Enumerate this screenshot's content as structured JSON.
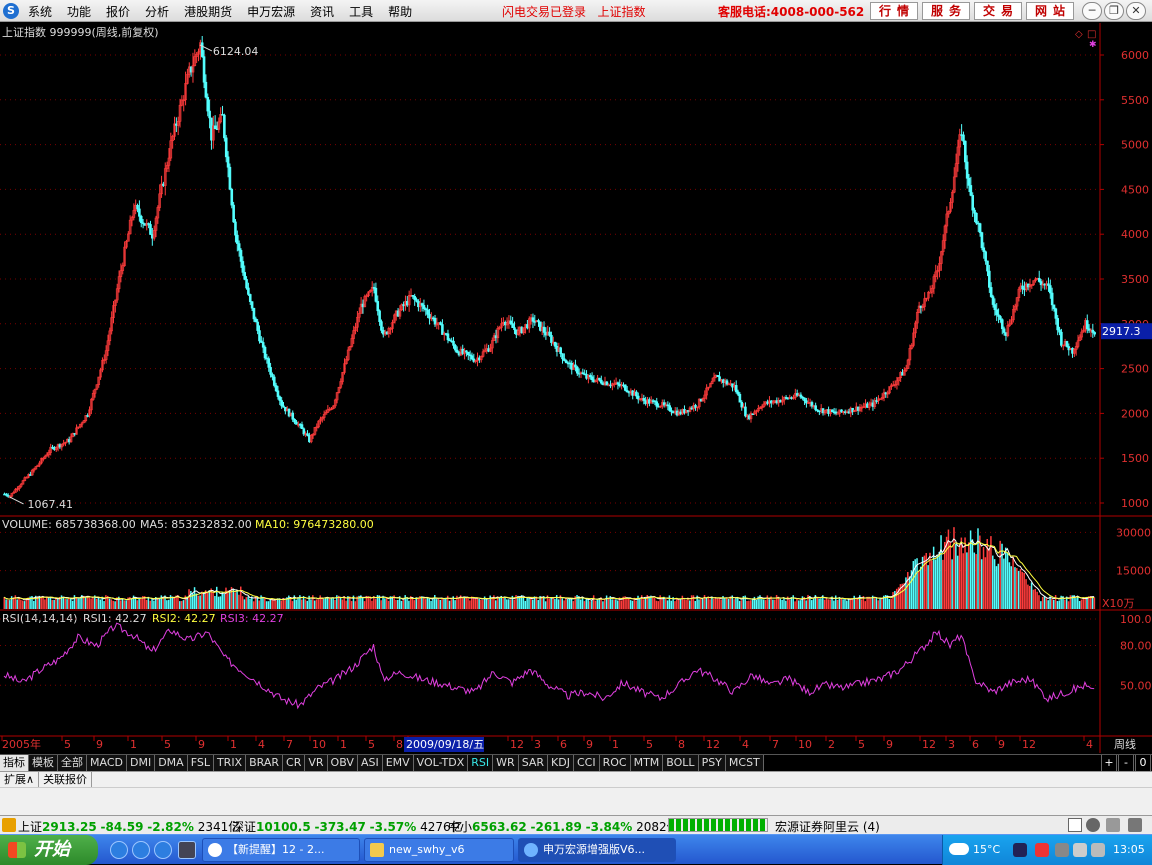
{
  "menubar": {
    "logo": "S",
    "items": [
      "系统",
      "功能",
      "报价",
      "分析",
      "港股期货",
      "申万宏源",
      "资讯",
      "工具",
      "帮助"
    ],
    "login_status": "闪电交易已登录",
    "current_index": "上证指数",
    "hotline": "客服电话:4008-000-562",
    "nav_buttons": [
      "行情",
      "服务",
      "交易",
      "网站"
    ]
  },
  "chart": {
    "title": "上证指数 999999(周线,前复权)",
    "high_label": "6124.04",
    "low_label": "1067.41",
    "current_price_tag": "2917.3",
    "period_label": "周线",
    "date_cursor": "2009/09/18/五",
    "price_ticks": [
      "6000",
      "5500",
      "5000",
      "4500",
      "4000",
      "3500",
      "3000",
      "2500",
      "2000",
      "1500",
      "1000"
    ],
    "volume_label": "VOLUME: 685738368.00",
    "ma5_label": "MA5: 853232832.00",
    "ma10_label": "MA10: 976473280.00",
    "volume_ticks": [
      "30000",
      "15000"
    ],
    "volume_unit": "X10万",
    "rsi_label": "RSI(14,14,14)",
    "rsi1_label": "RSI1: 42.27",
    "rsi2_label": "RSI2: 42.27",
    "rsi3_label": "RSI3: 42.27",
    "rsi_ticks": [
      "100.00",
      "80.00",
      "50.00"
    ],
    "x_ticks": [
      "2005年",
      "5",
      "9",
      "1",
      "5",
      "9",
      "1",
      "4",
      "7",
      "10",
      "1",
      "5",
      "8",
      "9",
      "12",
      "3",
      "6",
      "9",
      "1",
      "5",
      "8",
      "12",
      "4",
      "7",
      "10",
      "2",
      "5",
      "9",
      "12",
      "3",
      "6",
      "9",
      "12",
      "4"
    ]
  },
  "chart_data": [
    {
      "type": "candlestick",
      "title": "上证指数 999999(周线,前复权)",
      "annotations": {
        "high": 6124.04,
        "low": 1067.41,
        "last": 2917.3
      },
      "y_range": [
        1000,
        6000
      ],
      "close_path": [
        [
          0,
          1100
        ],
        [
          3,
          1080
        ],
        [
          8,
          1200
        ],
        [
          15,
          1350
        ],
        [
          25,
          1600
        ],
        [
          35,
          1700
        ],
        [
          45,
          2000
        ],
        [
          55,
          2700
        ],
        [
          62,
          3500
        ],
        [
          70,
          4300
        ],
        [
          80,
          4000
        ],
        [
          90,
          5000
        ],
        [
          100,
          5800
        ],
        [
          106,
          6124
        ],
        [
          112,
          5100
        ],
        [
          118,
          5300
        ],
        [
          125,
          4000
        ],
        [
          132,
          3300
        ],
        [
          140,
          2700
        ],
        [
          150,
          2100
        ],
        [
          160,
          1850
        ],
        [
          165,
          1700
        ],
        [
          170,
          1900
        ],
        [
          178,
          2100
        ],
        [
          185,
          2600
        ],
        [
          193,
          3200
        ],
        [
          200,
          3400
        ],
        [
          205,
          2850
        ],
        [
          212,
          3100
        ],
        [
          220,
          3300
        ],
        [
          228,
          3150
        ],
        [
          236,
          2950
        ],
        [
          245,
          2700
        ],
        [
          255,
          2600
        ],
        [
          263,
          2750
        ],
        [
          270,
          3050
        ],
        [
          278,
          2900
        ],
        [
          286,
          3050
        ],
        [
          295,
          2850
        ],
        [
          305,
          2550
        ],
        [
          315,
          2400
        ],
        [
          325,
          2350
        ],
        [
          335,
          2300
        ],
        [
          345,
          2150
        ],
        [
          355,
          2100
        ],
        [
          365,
          2000
        ],
        [
          375,
          2100
        ],
        [
          385,
          2400
        ],
        [
          395,
          2300
        ],
        [
          402,
          1950
        ],
        [
          410,
          2100
        ],
        [
          420,
          2150
        ],
        [
          430,
          2200
        ],
        [
          440,
          2050
        ],
        [
          450,
          2000
        ],
        [
          460,
          2050
        ],
        [
          470,
          2100
        ],
        [
          480,
          2300
        ],
        [
          488,
          2500
        ],
        [
          495,
          3200
        ],
        [
          500,
          3300
        ],
        [
          505,
          3600
        ],
        [
          512,
          4400
        ],
        [
          518,
          5166
        ],
        [
          522,
          4500
        ],
        [
          528,
          4000
        ],
        [
          535,
          3200
        ],
        [
          542,
          2900
        ],
        [
          550,
          3400
        ],
        [
          558,
          3500
        ],
        [
          565,
          3400
        ],
        [
          572,
          2800
        ],
        [
          578,
          2700
        ],
        [
          585,
          3000
        ],
        [
          590,
          2917
        ]
      ]
    },
    {
      "type": "bar",
      "title": "VOLUME",
      "series": [
        {
          "name": "MA5",
          "values": [
            853232832
          ]
        },
        {
          "name": "MA10",
          "values": [
            976473280
          ]
        }
      ],
      "value": 685738368,
      "y_unit": "X10万",
      "y_ticks": [
        15000,
        30000
      ]
    },
    {
      "type": "line",
      "title": "RSI(14,14,14)",
      "series": [
        {
          "name": "RSI1",
          "last": 42.27
        },
        {
          "name": "RSI2",
          "last": 42.27
        },
        {
          "name": "RSI3",
          "last": 42.27
        }
      ],
      "y_ticks": [
        50,
        80,
        100
      ],
      "path": [
        [
          0,
          58
        ],
        [
          10,
          52
        ],
        [
          20,
          62
        ],
        [
          30,
          70
        ],
        [
          40,
          86
        ],
        [
          50,
          80
        ],
        [
          60,
          95
        ],
        [
          70,
          88
        ],
        [
          80,
          75
        ],
        [
          90,
          92
        ],
        [
          100,
          84
        ],
        [
          110,
          90
        ],
        [
          120,
          70
        ],
        [
          130,
          60
        ],
        [
          140,
          50
        ],
        [
          150,
          40
        ],
        [
          160,
          35
        ],
        [
          170,
          48
        ],
        [
          180,
          55
        ],
        [
          190,
          65
        ],
        [
          200,
          80
        ],
        [
          205,
          55
        ],
        [
          215,
          60
        ],
        [
          225,
          55
        ],
        [
          235,
          52
        ],
        [
          245,
          48
        ],
        [
          255,
          45
        ],
        [
          265,
          60
        ],
        [
          275,
          52
        ],
        [
          285,
          62
        ],
        [
          295,
          50
        ],
        [
          305,
          42
        ],
        [
          315,
          45
        ],
        [
          325,
          40
        ],
        [
          335,
          52
        ],
        [
          345,
          45
        ],
        [
          355,
          40
        ],
        [
          365,
          50
        ],
        [
          375,
          62
        ],
        [
          385,
          55
        ],
        [
          395,
          45
        ],
        [
          405,
          58
        ],
        [
          415,
          50
        ],
        [
          425,
          55
        ],
        [
          435,
          45
        ],
        [
          445,
          50
        ],
        [
          455,
          48
        ],
        [
          465,
          52
        ],
        [
          475,
          55
        ],
        [
          485,
          62
        ],
        [
          495,
          75
        ],
        [
          505,
          90
        ],
        [
          512,
          80
        ],
        [
          518,
          88
        ],
        [
          525,
          55
        ],
        [
          535,
          45
        ],
        [
          545,
          52
        ],
        [
          555,
          55
        ],
        [
          565,
          40
        ],
        [
          575,
          45
        ],
        [
          585,
          50
        ],
        [
          590,
          45
        ]
      ]
    }
  ],
  "tabs": {
    "items": [
      "指标",
      "模板",
      "全部",
      "MACD",
      "DMI",
      "DMA",
      "FSL",
      "TRIX",
      "BRAR",
      "CR",
      "VR",
      "OBV",
      "ASI",
      "EMV",
      "VOL-TDX",
      "RSI",
      "WR",
      "SAR",
      "KDJ",
      "CCI",
      "ROC",
      "MTM",
      "BOLL",
      "PSY",
      "MCST"
    ],
    "controls": [
      "+",
      "-",
      "0"
    ]
  },
  "subtabs": [
    "扩展∧",
    "关联报价"
  ],
  "ticker": {
    "sh_name": "上证",
    "sh_value": "2913.25",
    "sh_change": "-84.59",
    "sh_pct": "-2.82%",
    "sh_amount": "2341亿",
    "sz_name": "深证",
    "sz_value": "10100.5",
    "sz_change": "-373.47",
    "sz_pct": "-3.57%",
    "sz_amount": "4276亿",
    "zx_name": "中小",
    "zx_value": "6563.62",
    "zx_change": "-261.89",
    "zx_pct": "-3.84%",
    "zx_amount": "2082亿",
    "broker": "宏源证券阿里云 (4)"
  },
  "taskbar": {
    "start_label": "开始",
    "tasks": [
      "【新提醒】12 - 2...",
      "new_swhy_v6",
      "申万宏源增强版V6..."
    ],
    "temperature": "15°C",
    "clock": "13:05"
  }
}
